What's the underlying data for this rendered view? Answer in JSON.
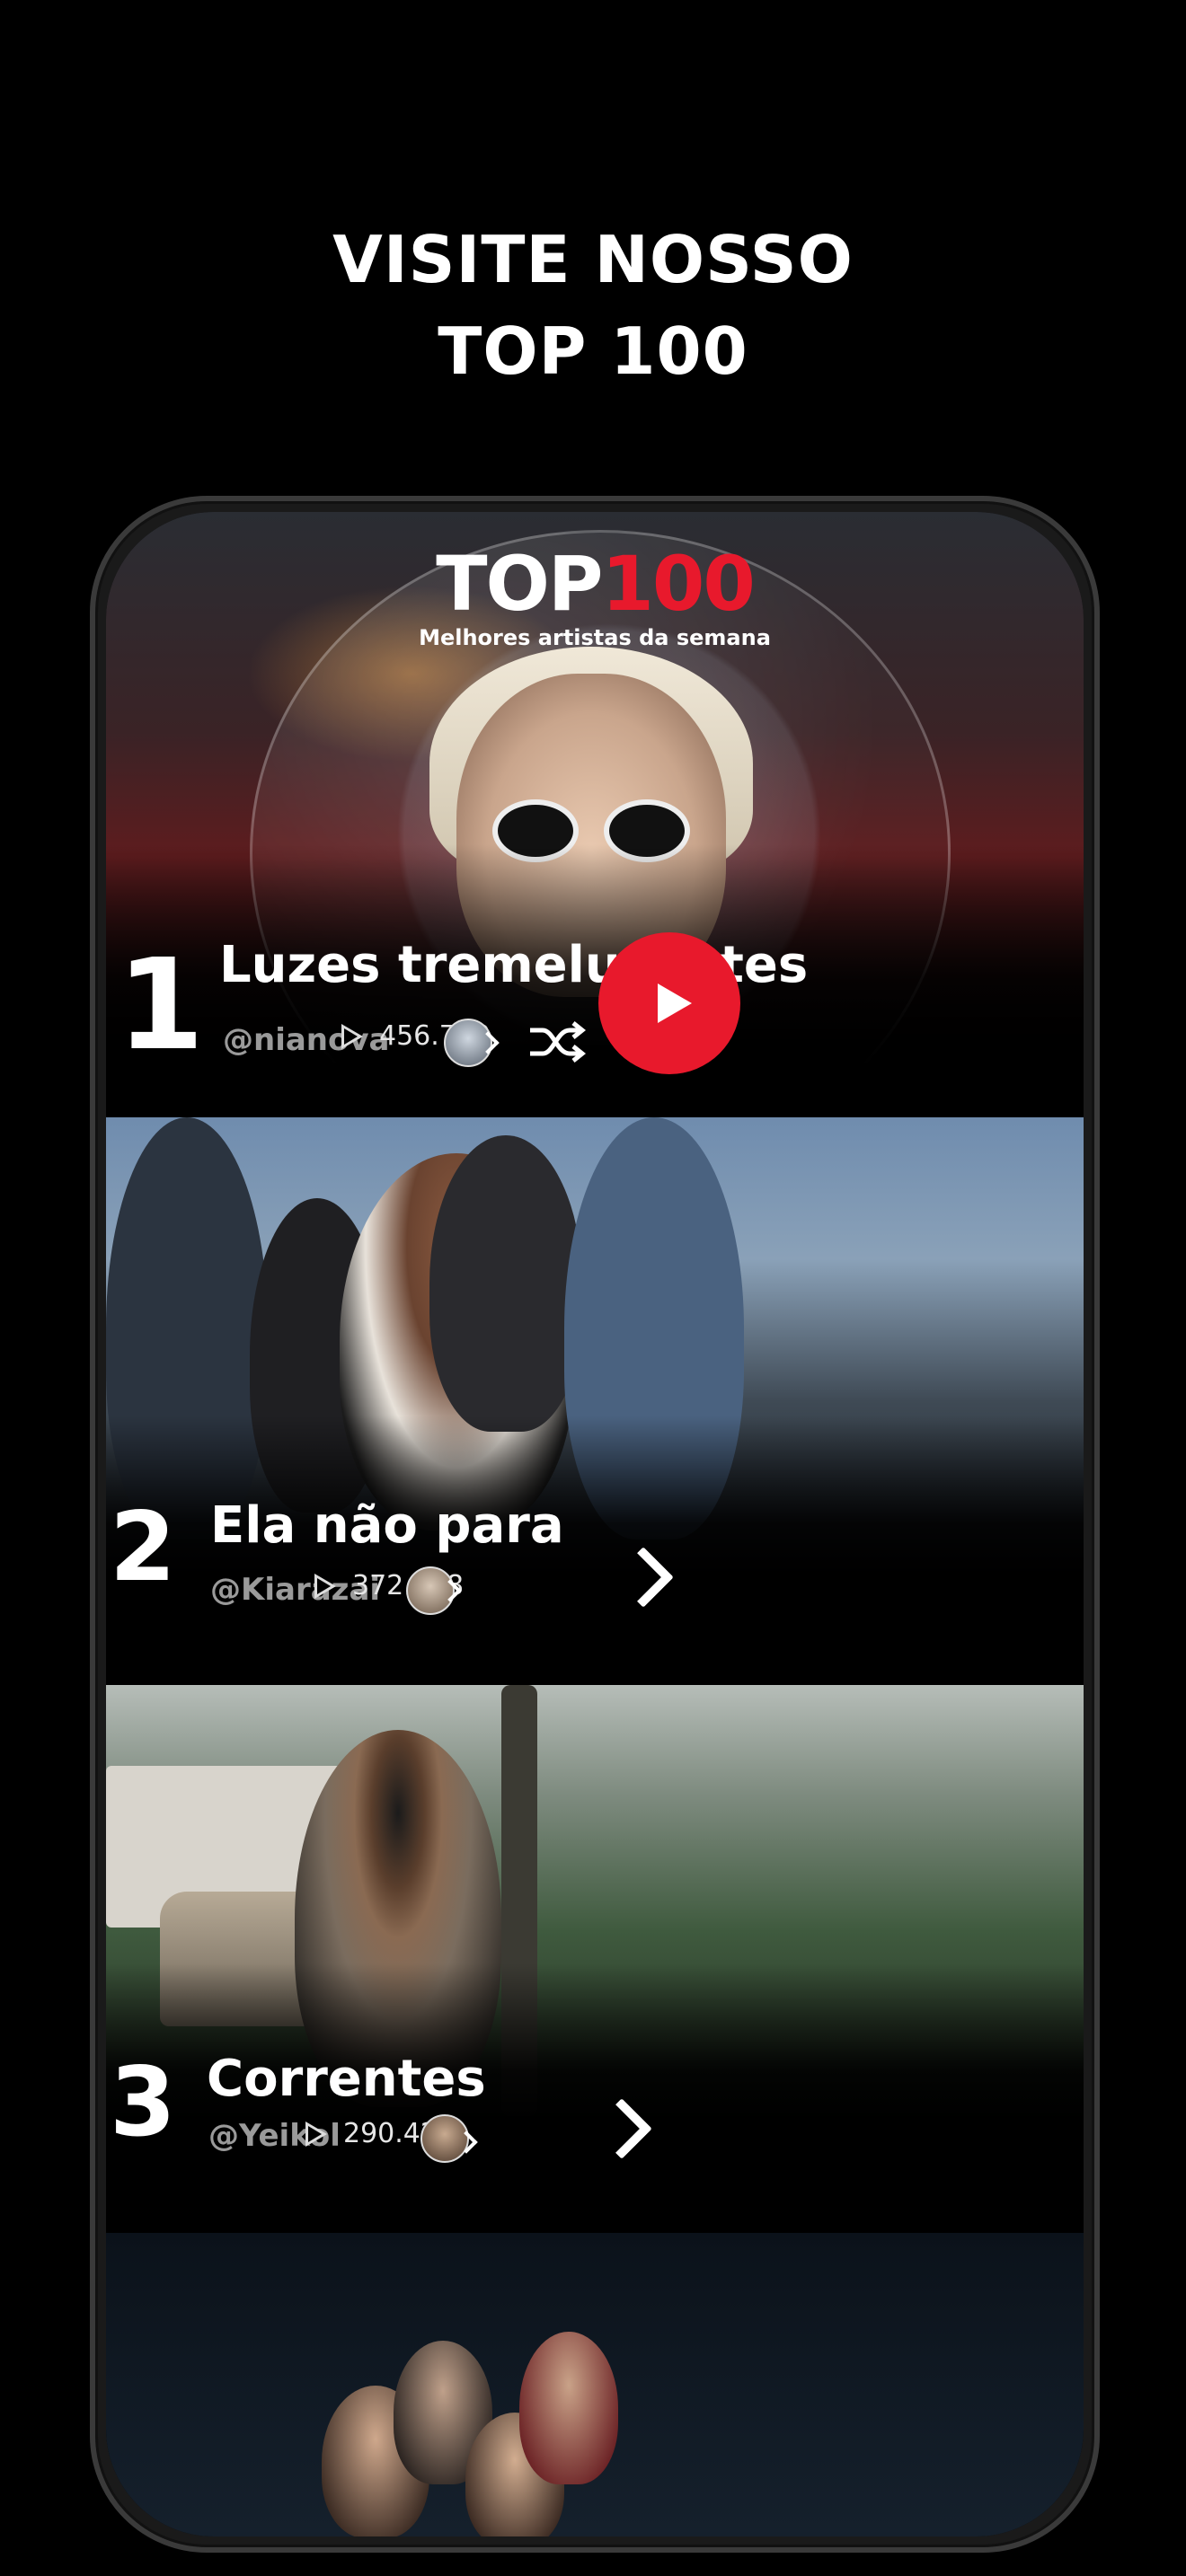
{
  "promo": {
    "headline_line1": "VISITE NOSSO",
    "headline_line2": "TOP 100"
  },
  "screen": {
    "logo_top": "TOP",
    "logo_100": "100",
    "logo_subtitle": "Melhores artistas da semana"
  },
  "items": [
    {
      "rank": "1",
      "title": "Luzes tremeluzentes",
      "handle": "@nianova",
      "plays": "456.780",
      "actions": [
        "youtube-play-button",
        "shuffle-icon"
      ]
    },
    {
      "rank": "2",
      "title": "Ela não para",
      "handle": "@Kiarazai",
      "plays": "372.198"
    },
    {
      "rank": "3",
      "title": "Correntes",
      "handle": "@Yeikol",
      "plays": "290.425"
    }
  ],
  "colors": {
    "background": "#000000",
    "accent_red": "#e8192c",
    "text": "#ffffff",
    "handle_gray": "#9a9a9a"
  },
  "icons": [
    "play-count-icon",
    "artist-avatar",
    "chevron-right-icon",
    "shuffle-icon",
    "youtube-play-icon"
  ]
}
